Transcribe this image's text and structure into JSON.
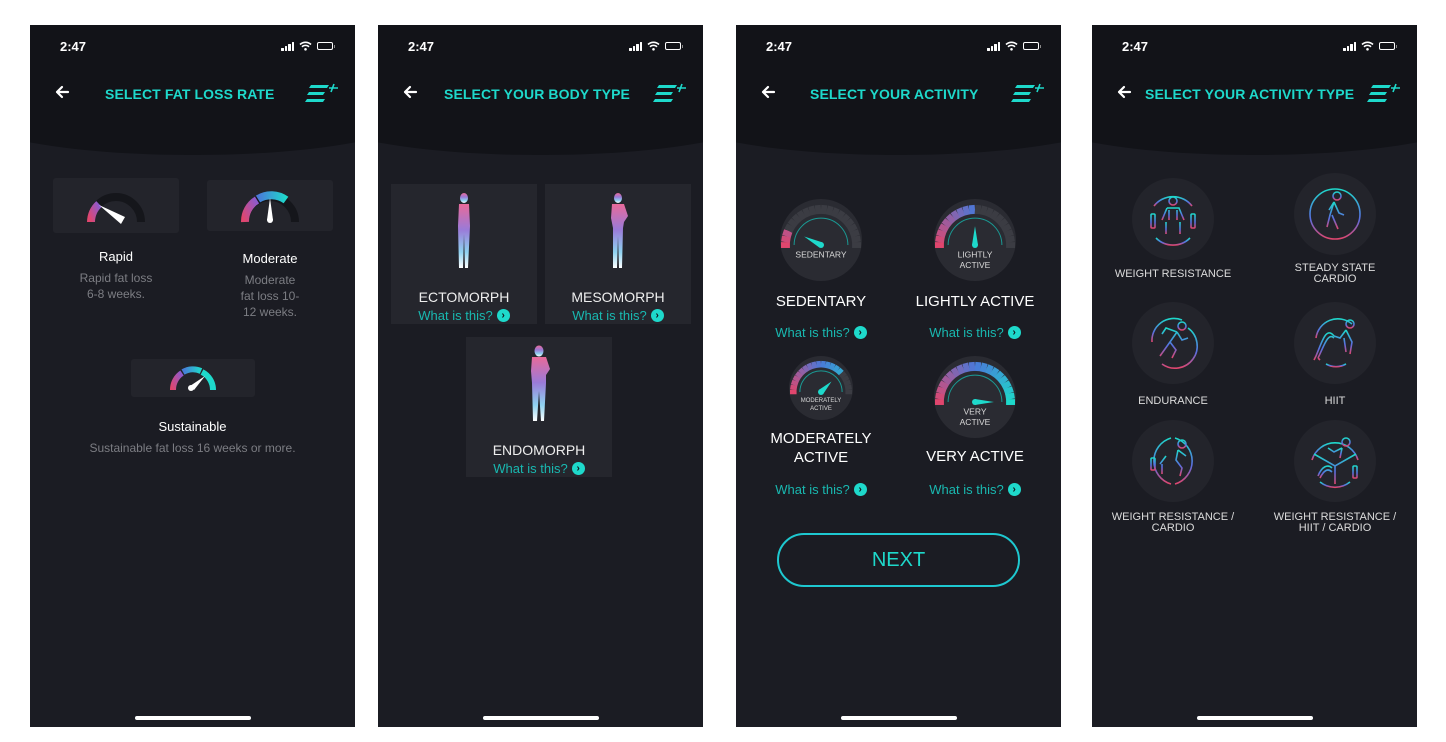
{
  "colors": {
    "accent": "#1ed9cb",
    "background": "#1b1c23",
    "header": "#121318",
    "card": "#25262d",
    "gauge_pink": "#e0466e",
    "gauge_blue": "#4a79d9",
    "gauge_teal": "#1ed9cb"
  },
  "status_bar": {
    "time": "2:47"
  },
  "icons": {
    "back": "arrow-left-icon",
    "logo": "brand-logo-icon",
    "chevron": "chevron-right-circle-icon"
  },
  "screen1": {
    "title": "SELECT FAT LOSS RATE",
    "options": [
      {
        "name": "Rapid",
        "description": "Rapid fat loss 6-8 weeks.",
        "gauge_level": "low"
      },
      {
        "name": "Moderate",
        "description": "Moderate fat loss 10-12 weeks.",
        "gauge_level": "medium"
      },
      {
        "name": "Sustainable",
        "description": "Sustainable fat loss 16 weeks or more.",
        "gauge_level": "high"
      }
    ]
  },
  "screen2": {
    "title": "SELECT YOUR BODY TYPE",
    "link_label": "What is this?",
    "options": [
      {
        "name": "ECTOMORPH"
      },
      {
        "name": "MESOMORPH"
      },
      {
        "name": "ENDOMORPH"
      }
    ]
  },
  "screen3": {
    "title": "SELECT YOUR ACTIVITY",
    "link_label": "What is this?",
    "next_label": "NEXT",
    "options": [
      {
        "name": "SEDENTARY",
        "gauge_label": "SEDENTARY",
        "level": 0.15
      },
      {
        "name": "LIGHTLY ACTIVE",
        "gauge_label": "LIGHTLY\nACTIVE",
        "level": 0.5
      },
      {
        "name": "MODERATELY ACTIVE",
        "gauge_label": "MODERATELY\nACTIVE",
        "level": 0.75
      },
      {
        "name": "VERY ACTIVE",
        "gauge_label": "VERY\nACTIVE",
        "level": 1.0
      }
    ]
  },
  "screen4": {
    "title": "SELECT YOUR ACTIVITY TYPE",
    "options": [
      {
        "name": "WEIGHT RESISTANCE",
        "icon": "weightlifting-icon"
      },
      {
        "name": "STEADY STATE CARDIO",
        "icon": "walking-icon"
      },
      {
        "name": "ENDURANCE",
        "icon": "running-icon"
      },
      {
        "name": "HIIT",
        "icon": "battle-ropes-icon"
      },
      {
        "name": "WEIGHT RESISTANCE / CARDIO",
        "icon": "weights-cardio-icon"
      },
      {
        "name": "WEIGHT RESISTANCE / HIIT / CARDIO",
        "icon": "weights-hiit-cardio-icon"
      }
    ]
  }
}
